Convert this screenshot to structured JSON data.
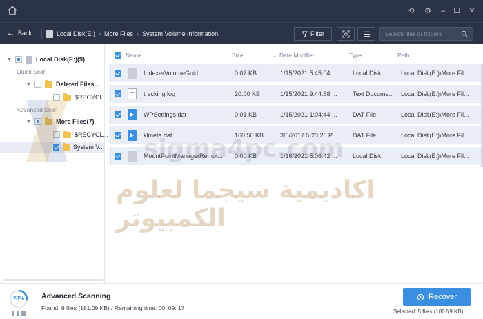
{
  "nav": {
    "back_label": "Back",
    "breadcrumbs": [
      "Local Disk(E:)",
      "More Files",
      "System Volume Information"
    ],
    "filter_label": "Filter",
    "search_placeholder": "Search files or folders"
  },
  "tree": {
    "root_label": "Local Disk(E:)(9)",
    "quick_scan_label": "Quick Scan",
    "deleted_files_label": "Deleted Files...",
    "recycle_label_1": "$RECYCL...",
    "advanced_scan_label": "Advanced Scan",
    "more_files_label": "More Files(7)",
    "recycle_label_2": "$RECYCL...",
    "system_volume_label": "System V..."
  },
  "table": {
    "columns": [
      "Name",
      "Size",
      "Date Modified",
      "Type",
      "Path"
    ],
    "rows": [
      {
        "name": "IndexerVolumeGuid",
        "size": "0.07 KB",
        "date": "1/15/2021 5:45:04 ...",
        "type": "Local Disk",
        "path": "Local Disk(E:)\\More Fil..."
      },
      {
        "name": "tracking.log",
        "size": "20.00 KB",
        "date": "1/15/2021 9:44:58 ...",
        "type": "Text Docume...",
        "path": "Local Disk(E:)\\More Fil..."
      },
      {
        "name": "WPSettings.dat",
        "size": "0.01 KB",
        "date": "1/15/2021 1:04:44 ...",
        "type": "DAT File",
        "path": "Local Disk(E:)\\More Fil..."
      },
      {
        "name": "klmeta.dat",
        "size": "160.50 KB",
        "date": "3/5/2017 5:23:26 P...",
        "type": "DAT File",
        "path": "Local Disk(E:)\\More Fil..."
      },
      {
        "name": "MountPointManagerRemot...",
        "size": "0.00 KB",
        "date": "1/16/2021 5:06:42 ...",
        "type": "Local Disk",
        "path": "Local Disk(E:)\\More Fil..."
      }
    ]
  },
  "watermark": {
    "latin": "sigma4pc.com",
    "arabic": "اكاديمية سيجما لعلوم الكمبيوتر"
  },
  "status": {
    "progress_text": "28%",
    "progress_fraction": 0.28,
    "title": "Advanced Scanning",
    "detail": "Found: 9 files (181.09 KB) / Remaining time: 00: 09: 17",
    "recover_label": "Recover",
    "selected_text": "Selected: 5 files (180.59 KB)"
  },
  "colors": {
    "titlebar": "#2b3447",
    "accent": "#3b8fe0",
    "folder": "#f2c14e",
    "row_bg": "#e9edf5"
  }
}
